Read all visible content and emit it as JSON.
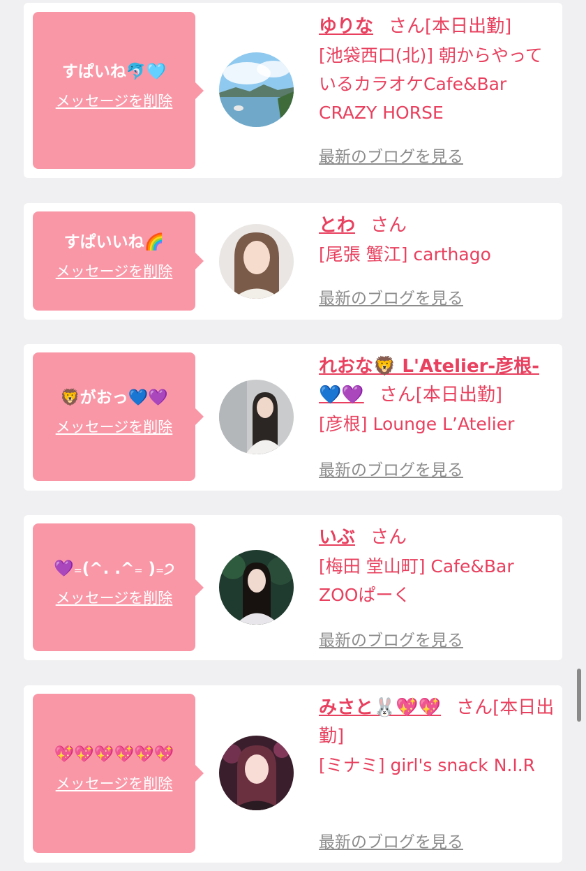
{
  "entries": [
    {
      "message": "すぱいね🐬🩵",
      "delete_label": "メッセージを削除",
      "name": "ゆりな",
      "suffix": "さん[本日出勤]",
      "shop": "[池袋西口(北)] 朝からやっているカラオケCafe&Bar CRAZY HORSE",
      "blog_label": "最新のブログを見る"
    },
    {
      "message": "すぱいいね🌈",
      "delete_label": "メッセージを削除",
      "name": "とわ",
      "suffix": "さん",
      "shop": "[尾張 蟹江] carthago",
      "blog_label": "最新のブログを見る"
    },
    {
      "message": "🦁がおっ💙💜",
      "delete_label": "メッセージを削除",
      "name": "れおな🦁 L'Atelier-彦根-💙💜",
      "suffix": "さん[本日出勤]",
      "shop": "[彦根] Lounge L’Atelier",
      "blog_label": "最新のブログを見る"
    },
    {
      "message": "💜₌(^. .^₌ )₌੭",
      "delete_label": "メッセージを削除",
      "name": "いぶ",
      "suffix": "さん",
      "shop": "[梅田 堂山町] Cafe&Bar ZOOぱーく",
      "blog_label": "最新のブログを見る"
    },
    {
      "message": "💖💖💖💖💖💖",
      "delete_label": "メッセージを削除",
      "name": "みさと🐰💖💖",
      "suffix": "さん[本日出勤]",
      "shop": "[ミナミ] girl's snack N.I.R",
      "blog_label": "最新のブログを見る"
    }
  ]
}
